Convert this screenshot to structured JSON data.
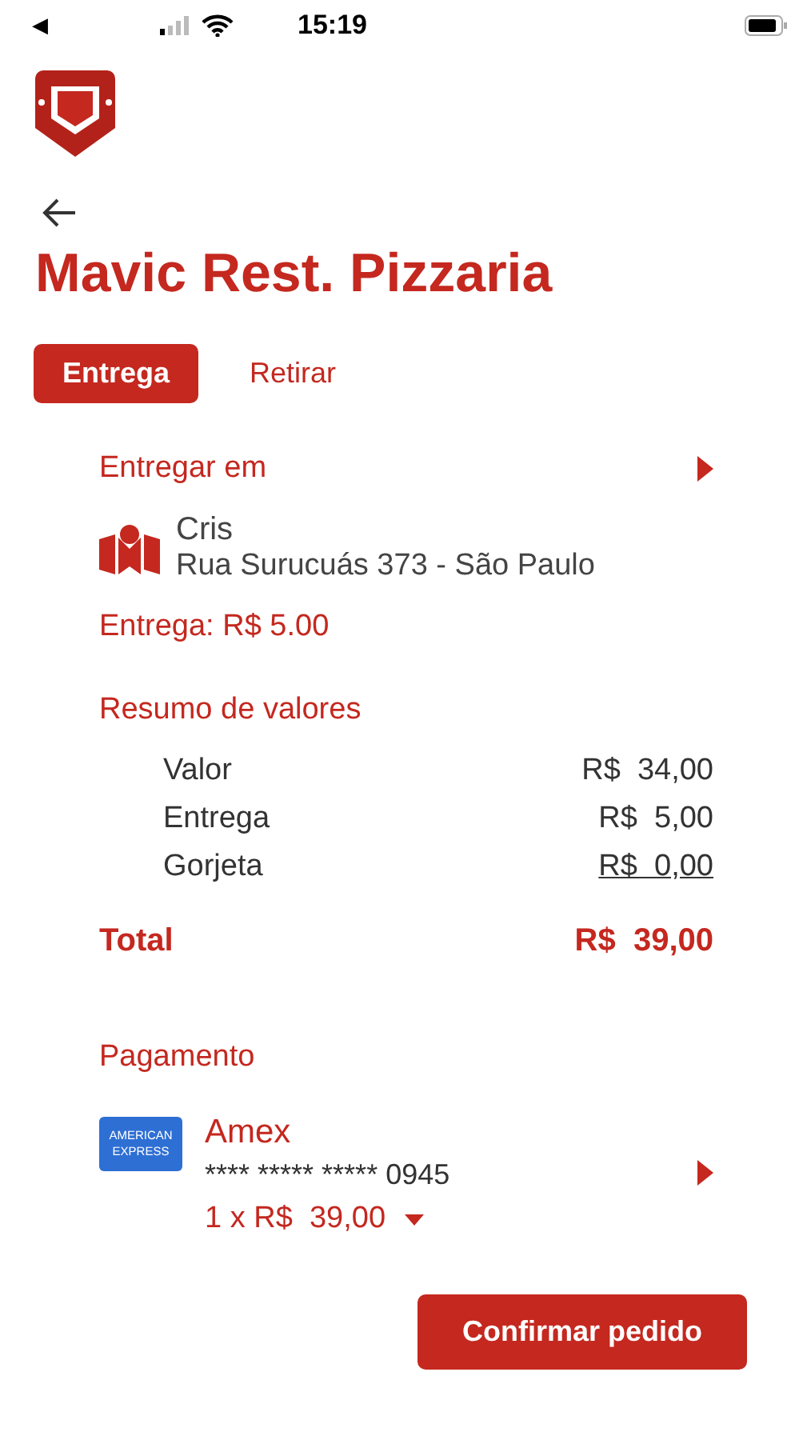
{
  "status_bar": {
    "back": "◀",
    "time": "15:19"
  },
  "title": "Mavic Rest. Pizzaria",
  "tabs": [
    {
      "label": "Entrega",
      "selected": true
    },
    {
      "label": "Retirar",
      "selected": false
    }
  ],
  "delivery": {
    "heading": "Entregar em",
    "name": "Cris",
    "address": "Rua Surucuás 373 - São Paulo",
    "fee": "Entrega: R$ 5.00"
  },
  "summary": {
    "heading": "Resumo de valores",
    "rows": [
      {
        "label": "Valor",
        "value": "R$  34,00",
        "underlined": false
      },
      {
        "label": "Entrega",
        "value": "R$  5,00",
        "underlined": false
      },
      {
        "label": "Gorjeta",
        "value": "R$  0,00",
        "underlined": true
      }
    ],
    "total_label": "Total",
    "total_value": "R$  39,00"
  },
  "payment": {
    "heading": "Pagamento",
    "card_logo": [
      "AMERICAN",
      "EXPRESS"
    ],
    "brand": "Amex",
    "number": "**** ***** ***** 0945",
    "installments": "1 x R$  39,00"
  },
  "confirm_button": "Confirmar pedido"
}
